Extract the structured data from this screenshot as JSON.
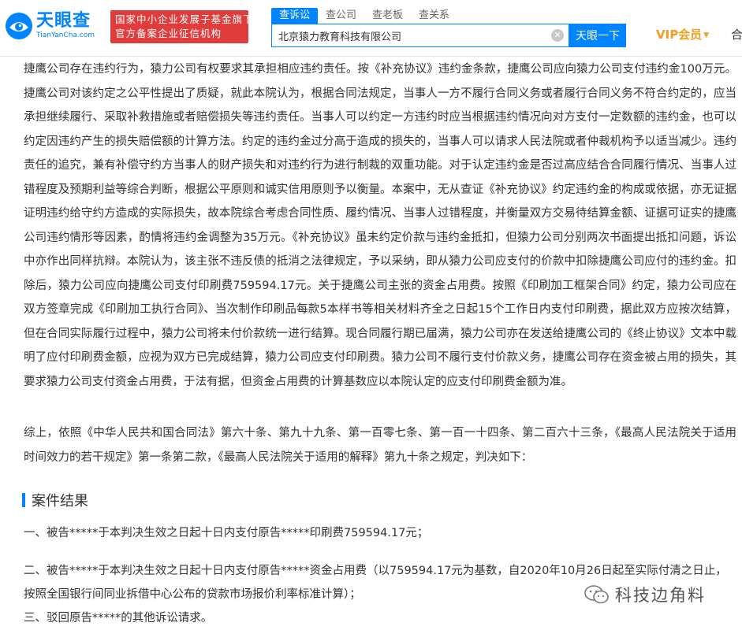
{
  "header": {
    "logo_cn": "天眼查",
    "logo_en": "TianYanCha.com",
    "badge_line1": "国家中小企业发展子基金旗下",
    "badge_line2": "官方备案企业征信机构",
    "tabs": [
      {
        "label": "查诉讼",
        "active": true
      },
      {
        "label": "查公司",
        "active": false
      },
      {
        "label": "查老板",
        "active": false
      },
      {
        "label": "查关系",
        "active": false
      }
    ],
    "search_value": "北京猿力教育科技有限公司",
    "search_button": "天眼一下",
    "vip_label": "VIP会员",
    "trail_text": "合"
  },
  "body": {
    "paragraph1": "捷鹰公司存在违约行为，猿力公司有权要求其承担相应违约责任。按《补充协议》违约金条款，捷鹰公司应向猿力公司支付违约金100万元。捷鹰公司对该约定之公平性提出了质疑，就此本院认为，根据合同法规定，当事人一方不履行合同义务或者履行合同义务不符合约定的，应当承担继续履行、采取补救措施或者赔偿损失等违约责任。当事人可以约定一方违约时应当根据违约情况向对方支付一定数额的违约金，也可以约定因违约产生的损失赔偿额的计算方法。约定的违约金过分高于造成的损失的，当事人可以请求人民法院或者仲裁机构予以适当减少。违约责任的追究，兼有补偿守约方当事人的财产损失和对违约行为进行制裁的双重功能。对于认定违约金是否过高应结合合同履行情况、当事人过错程度及预期利益等综合判断，根据公平原则和诚实信用原则予以衡量。本案中，无从查证《补充协议》约定违约金的构成或依据，亦无证据证明违约给守约方造成的实际损失，故本院综合考虑合同性质、履约情况、当事人过错程度，并衡量双方交易待结算金额、证据可证实的捷鹰公司违约情形等因素，酌情将违约金调整为35万元。《补充协议》虽未约定价款与违约金抵扣，但猿力公司分别两次书面提出抵扣问题，诉讼中亦作出同样抗辩。本院认为，该主张不违反债的抵消之法律规定，予以采纳，即从猿力公司应支付的价款中扣除捷鹰公司应付的违约金。扣除后，猿力公司应向捷鹰公司支付印刷费759594.17元。关于捷鹰公司主张的资金占用费。按照《印刷加工框架合同》约定，猿力公司应在双方签章完成《印刷加工执行合同》、当次制作印刷品每款5本样书等相关材料齐全之日起15个工作日内支付印刷费，据此双方应按次结算，但在合同实际履行过程中，猿力公司将未付价款统一进行结算。现合同履行期已届满，猿力公司亦在发送给捷鹰公司的《终止协议》文本中载明了应付印刷费金额，应视为双方已完成结算，猿力公司应支付印刷费。猿力公司不履行支付价款义务，捷鹰公司存在资金被占用的损失，其要求猿力公司支付资金占用费，于法有据，但资金占用费的计算基数应以本院认定的应支付印刷费金额为准。",
    "paragraph2": "综上，依照《中华人民共和国合同法》第六十条、第九十九条、第一百零七条、第一百一十四条、第二百六十三条，《最高人民法院关于适用时间效力的若干规定》第一条第二款，《最高人民法院关于适用的解释》第九十条之规定，判决如下：",
    "section_title": "案件结果",
    "result1": "一、被告*****于本判决生效之日起十日内支付原告*****印刷费759594.17元；",
    "result2": "二、被告*****于本判决生效之日起十日内支付原告*****资金占用费（以759594.17元为基数，自2020年10月26日起至实际付清之日止，按照全国银行间同业拆借中心公布的贷款市场报价利率标准计算）；",
    "result3": "三、驳回原告*****的其他诉讼请求。",
    "watermark_text": "科技边角料"
  },
  "colors": {
    "brand_blue": "#0084ff",
    "badge_red": "#e13c3c",
    "vip_gold": "#f29e1f"
  }
}
